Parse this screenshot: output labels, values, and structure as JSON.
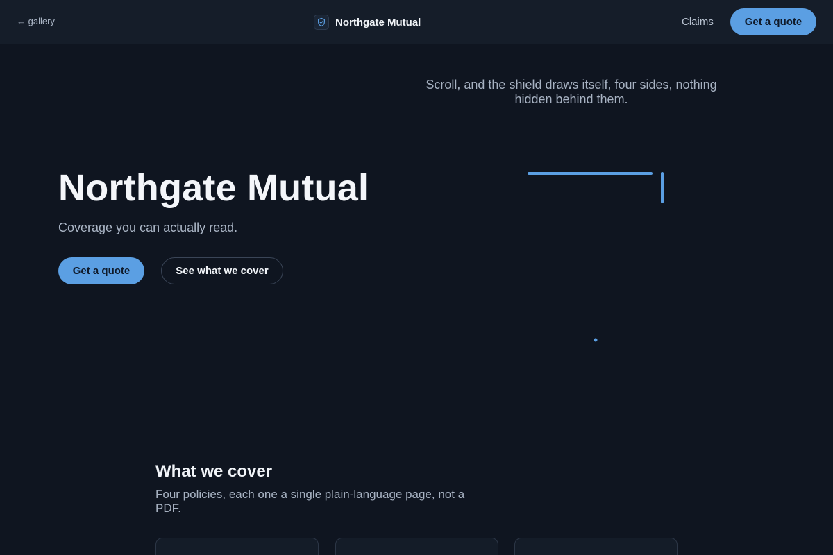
{
  "topbar": {
    "back_label": "← gallery",
    "brand_name": "Northgate Mutual",
    "brand_icon": "shield-check-icon",
    "claims_label": "Claims",
    "quote_label": "Get a quote"
  },
  "hero": {
    "title": "Northgate Mutual",
    "subtitle": "Coverage you can actually read.",
    "primary_label": "Get a quote",
    "secondary_label": "See what we cover"
  },
  "shield": {
    "caption": "Scroll, and the shield draws itself, four sides, nothing hidden behind them.",
    "color": "#5b9fe3"
  },
  "coverage": {
    "title": "What we cover",
    "description": "Four policies, each one a single plain-language page, not a PDF."
  },
  "colors": {
    "background": "#0f1520",
    "accent": "#5b9fe3"
  }
}
